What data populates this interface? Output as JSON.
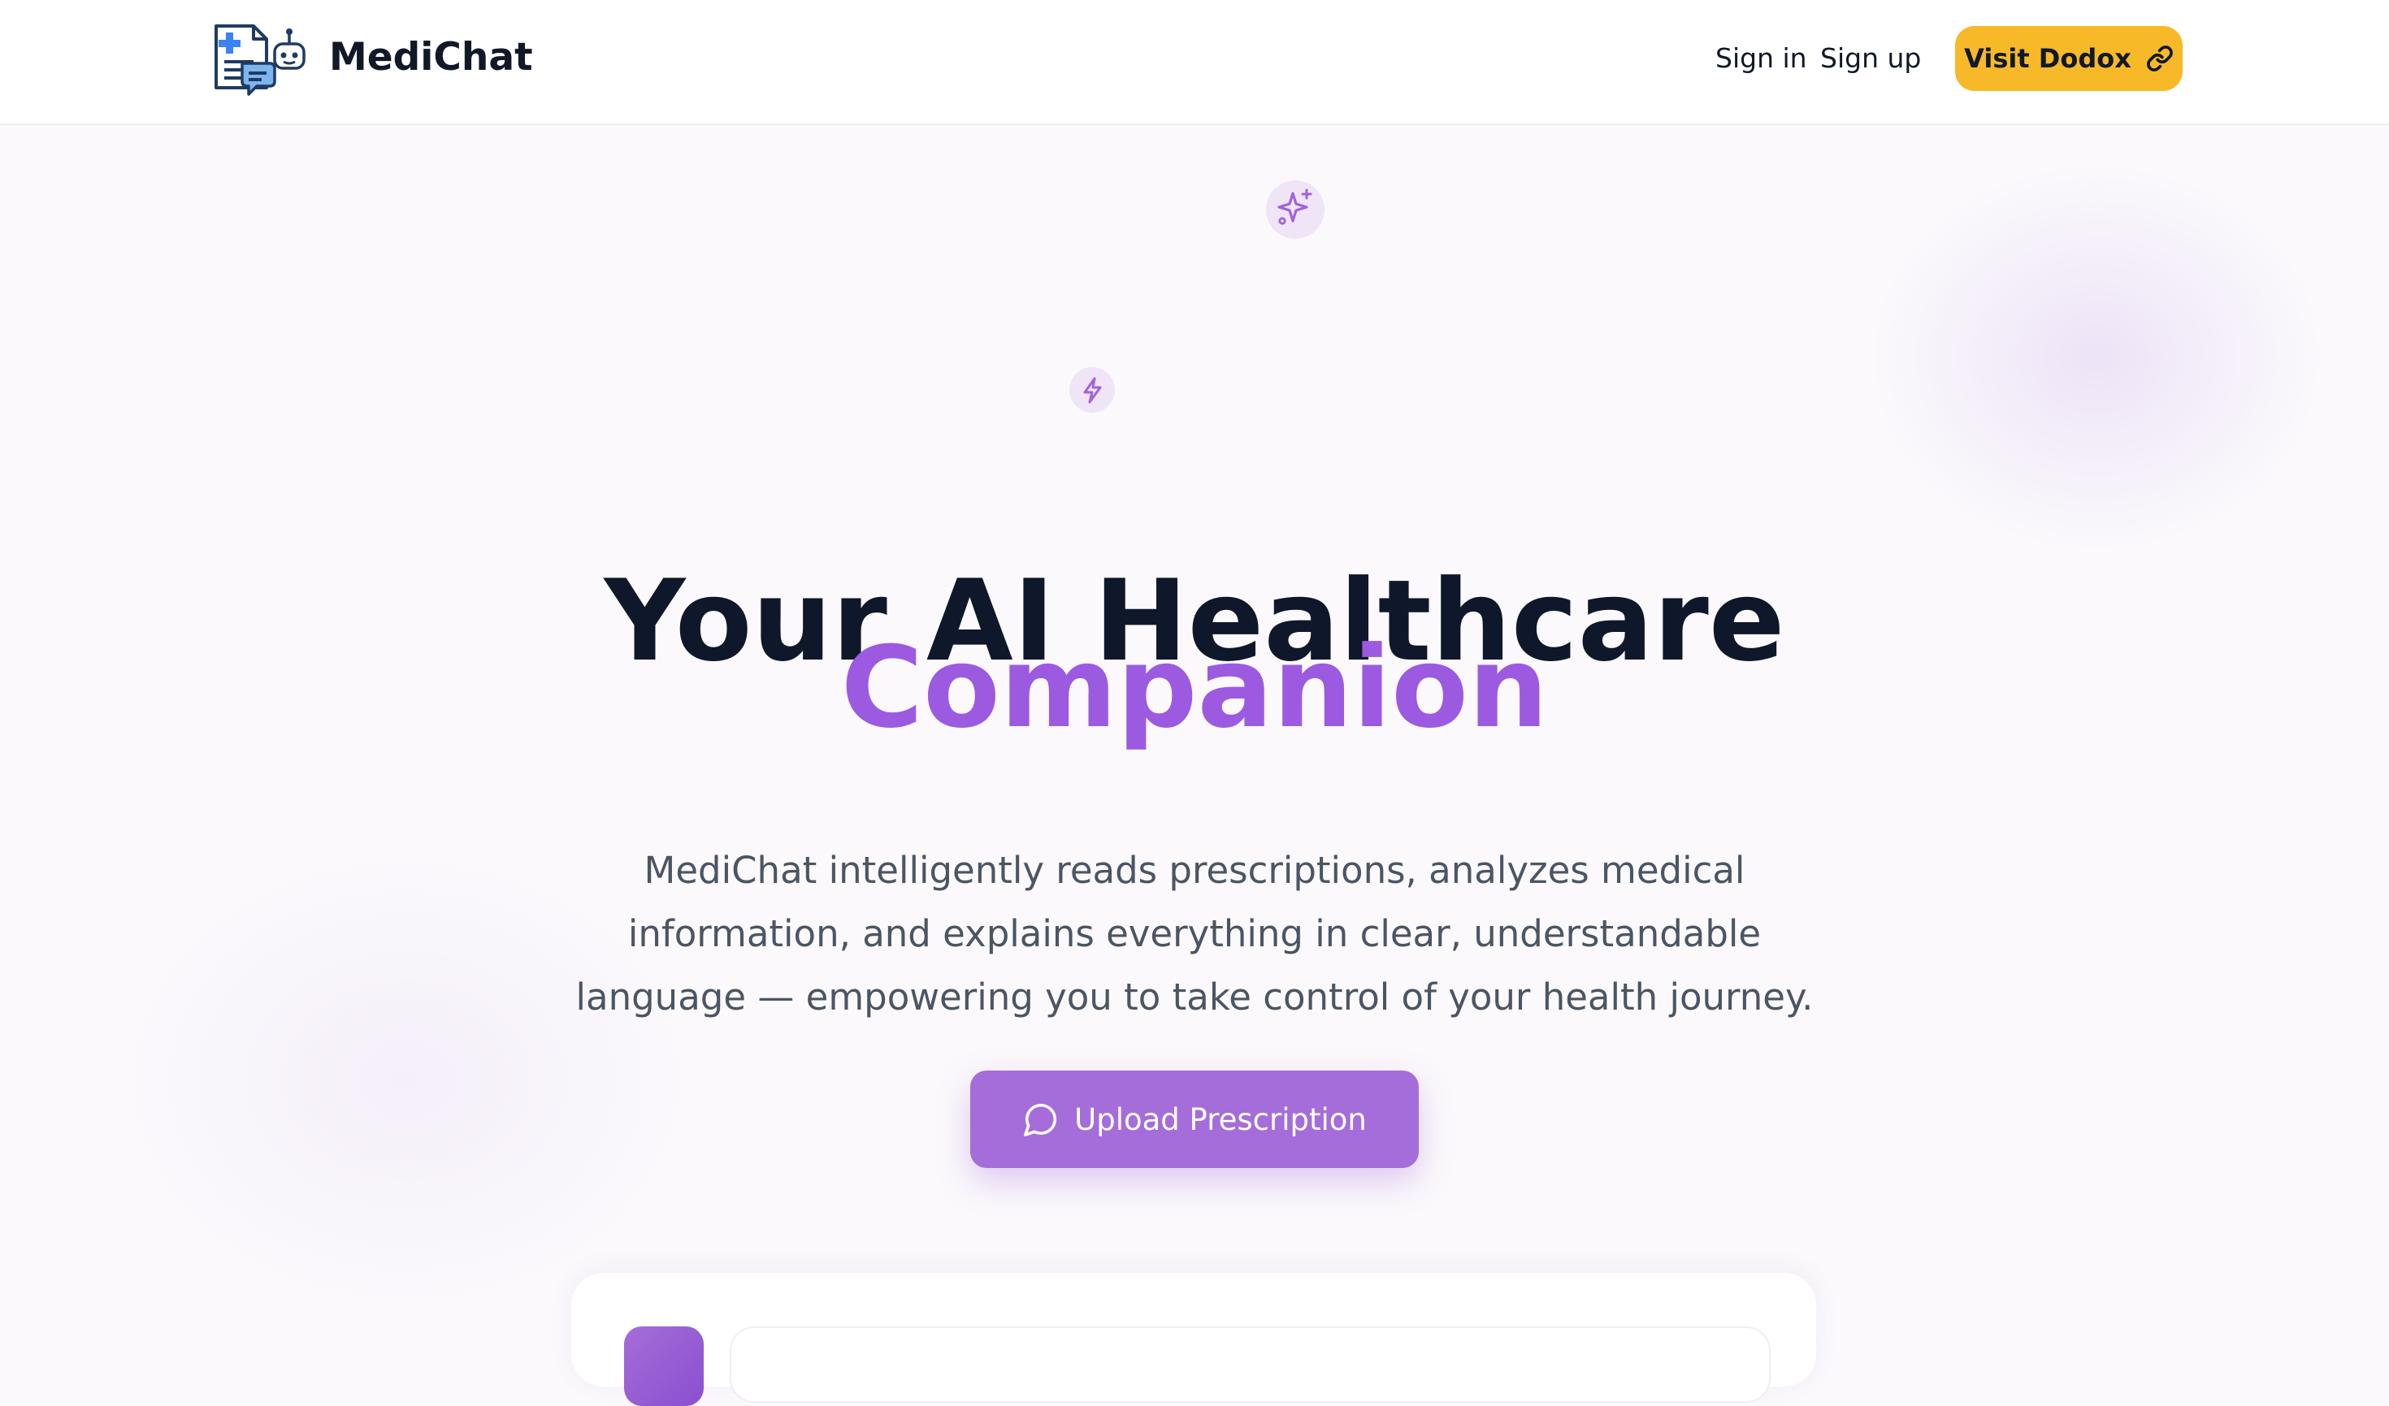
{
  "navbar": {
    "brand": "MediChat",
    "links": [
      "Sign in",
      "Sign up"
    ],
    "cta_label": "Visit Dodox"
  },
  "hero": {
    "headline_line1": "Your AI Healthcare",
    "headline_line2": "Companion",
    "description": "MediChat intelligently reads prescriptions, analyzes medical information, and explains everything in clear, understandable language — empowering you to take control of your health journey.",
    "cta_label": "Upload Prescription"
  },
  "colors": {
    "accent": "#9c5ae0",
    "button": "#a56dd9",
    "visit_button": "#f7b928",
    "heading": "#0f172a",
    "body_text": "#4b5563"
  },
  "icons": {
    "logo": "medichat-logo-icon",
    "visit": "link-icon",
    "hero": "sound-wave-icon",
    "sparkle": "sparkles-icon",
    "bolt": "lightning-icon",
    "upload": "chat-bubble-icon"
  }
}
